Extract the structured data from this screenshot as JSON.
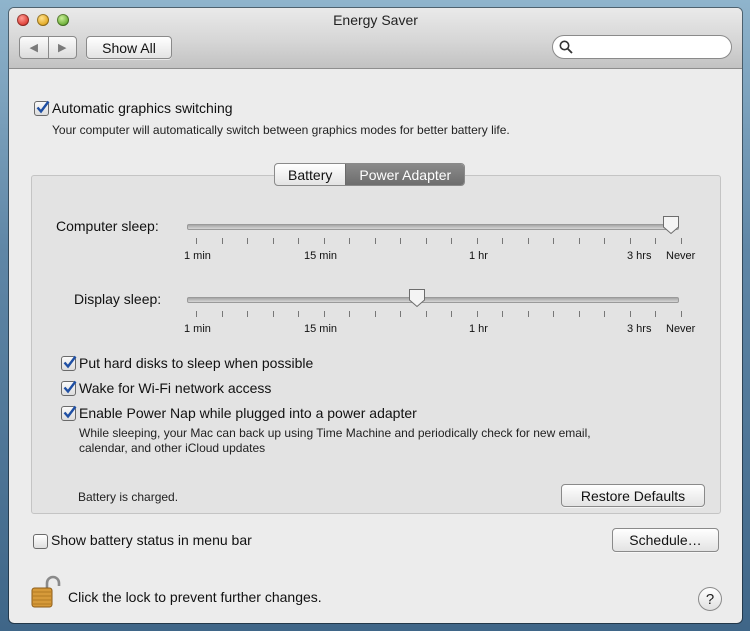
{
  "window": {
    "title": "Energy Saver",
    "show_all": "Show All",
    "search_placeholder": ""
  },
  "auto_graphics": {
    "label": "Automatic graphics switching",
    "checked": true,
    "description": "Your computer will automatically switch between graphics modes for better battery life."
  },
  "tabs": [
    {
      "label": "Battery",
      "selected": false
    },
    {
      "label": "Power Adapter",
      "selected": true
    }
  ],
  "computer_sleep": {
    "label": "Computer sleep:",
    "value": "Never",
    "ticks": [
      "1 min",
      "15 min",
      "1 hr",
      "3 hrs",
      "Never"
    ]
  },
  "display_sleep": {
    "label": "Display sleep:",
    "value_position_fraction": 0.47,
    "ticks": [
      "1 min",
      "15 min",
      "1 hr",
      "3 hrs",
      "Never"
    ]
  },
  "options": [
    {
      "label": "Put hard disks to sleep when possible",
      "checked": true
    },
    {
      "label": "Wake for Wi-Fi network access",
      "checked": true
    },
    {
      "label": "Enable Power Nap while plugged into a power adapter",
      "checked": true
    }
  ],
  "power_nap_description_line1": "While sleeping, your Mac can back up using Time Machine and periodically check for new email,",
  "power_nap_description_line2": "calendar, and other iCloud updates",
  "battery_status": "Battery is charged.",
  "restore_defaults": "Restore Defaults",
  "menu_bar_status": {
    "label": "Show battery status in menu bar",
    "checked": false
  },
  "schedule": "Schedule…",
  "lock_text": "Click the lock to prevent further changes.",
  "help": "?",
  "colors": {
    "accent": "#2f6fd6",
    "selected_tab": "#7a7a7a"
  }
}
